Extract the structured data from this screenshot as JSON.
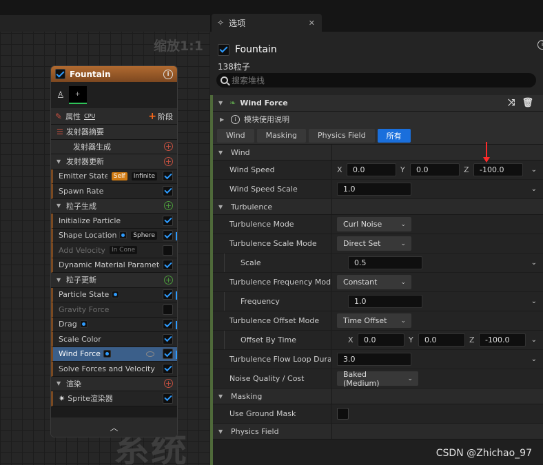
{
  "graph": {
    "zoom_label": "缩放1:1",
    "watermark_text": "系统"
  },
  "node": {
    "title": "Fountain",
    "attributes_label": "属性",
    "cpu_label": "CPU",
    "stage_label": "阶段",
    "rows": [
      {
        "kind": "header",
        "label": "发射器摘要"
      },
      {
        "kind": "section",
        "label": "发射器生成",
        "plus": "red",
        "collapsible": false
      },
      {
        "kind": "section",
        "label": "发射器更新",
        "plus": "red",
        "collapsible": true
      },
      {
        "kind": "item",
        "label": "Emitter State",
        "badges": [
          "Self",
          "Infinite"
        ],
        "checked": true
      },
      {
        "kind": "item",
        "label": "Spawn Rate",
        "checked": true
      },
      {
        "kind": "section",
        "label": "粒子生成",
        "plus": "green",
        "collapsible": true
      },
      {
        "kind": "item",
        "label": "Initialize Particle",
        "checked": true
      },
      {
        "kind": "item",
        "label": "Shape Location",
        "icon": true,
        "badges": [
          "Sphere"
        ],
        "checked": true,
        "bar": true
      },
      {
        "kind": "item",
        "label": "Add Velocity",
        "badges": [
          "In Cone"
        ],
        "checked": false,
        "dim": true
      },
      {
        "kind": "item",
        "label": "Dynamic Material Parameters",
        "checked": true
      },
      {
        "kind": "section",
        "label": "粒子更新",
        "plus": "green",
        "collapsible": true
      },
      {
        "kind": "item",
        "label": "Particle State",
        "icon": true,
        "checked": true,
        "bar": true
      },
      {
        "kind": "item",
        "label": "Gravity Force",
        "checked": false,
        "dim": true
      },
      {
        "kind": "item",
        "label": "Drag",
        "icon": true,
        "checked": true,
        "bar": true
      },
      {
        "kind": "item",
        "label": "Scale Color",
        "checked": true
      },
      {
        "kind": "item",
        "label": "Wind Force",
        "icon": true,
        "checked": true,
        "selected": true,
        "bar": true
      },
      {
        "kind": "item",
        "label": "Solve Forces and Velocity",
        "checked": true
      },
      {
        "kind": "section",
        "label": "渲染",
        "plus": "red",
        "collapsible": true
      },
      {
        "kind": "item",
        "label": "Sprite渲染器",
        "checked": true,
        "sprite": true
      }
    ]
  },
  "panel": {
    "tab_label": "选项",
    "emitter_name": "Fountain",
    "particle_count": "138粒子",
    "search_placeholder": "搜索堆栈",
    "module_title": "Wind Force",
    "usage_label": "模块使用说明",
    "filters": [
      {
        "label": "Wind",
        "active": false
      },
      {
        "label": "Masking",
        "active": false
      },
      {
        "label": "Physics Field",
        "active": false
      },
      {
        "label": "所有",
        "active": true
      }
    ],
    "sections": {
      "wind": "Wind",
      "turbulence": "Turbulence",
      "masking": "Masking",
      "physics_field": "Physics Field"
    },
    "props": {
      "wind_speed": {
        "label": "Wind Speed",
        "x": "0.0",
        "y": "0.0",
        "z": "-100.0"
      },
      "wind_speed_scale": {
        "label": "Wind Speed Scale",
        "value": "1.0"
      },
      "turbulence_mode": {
        "label": "Turbulence Mode",
        "value": "Curl Noise"
      },
      "turbulence_scale_mode": {
        "label": "Turbulence Scale Mode",
        "value": "Direct Set"
      },
      "scale": {
        "label": "Scale",
        "value": "0.5"
      },
      "turbulence_frequency_mode": {
        "label": "Turbulence Frequency Mode",
        "value": "Constant"
      },
      "frequency": {
        "label": "Frequency",
        "value": "1.0"
      },
      "turbulence_offset_mode": {
        "label": "Turbulence Offset Mode",
        "value": "Time Offset"
      },
      "offset_by_time": {
        "label": "Offset By Time",
        "x": "0.0",
        "y": "0.0",
        "z": "-100.0"
      },
      "turbulence_flow_loop": {
        "label": "Turbulence Flow Loop Durati",
        "value": "3.0"
      },
      "noise_quality": {
        "label": "Noise Quality / Cost",
        "value": "Baked (Medium)"
      },
      "use_ground_mask": {
        "label": "Use Ground Mask"
      }
    },
    "axis": {
      "x": "X",
      "y": "Y",
      "z": "Z"
    }
  },
  "watermark": "CSDN @Zhichao_97"
}
